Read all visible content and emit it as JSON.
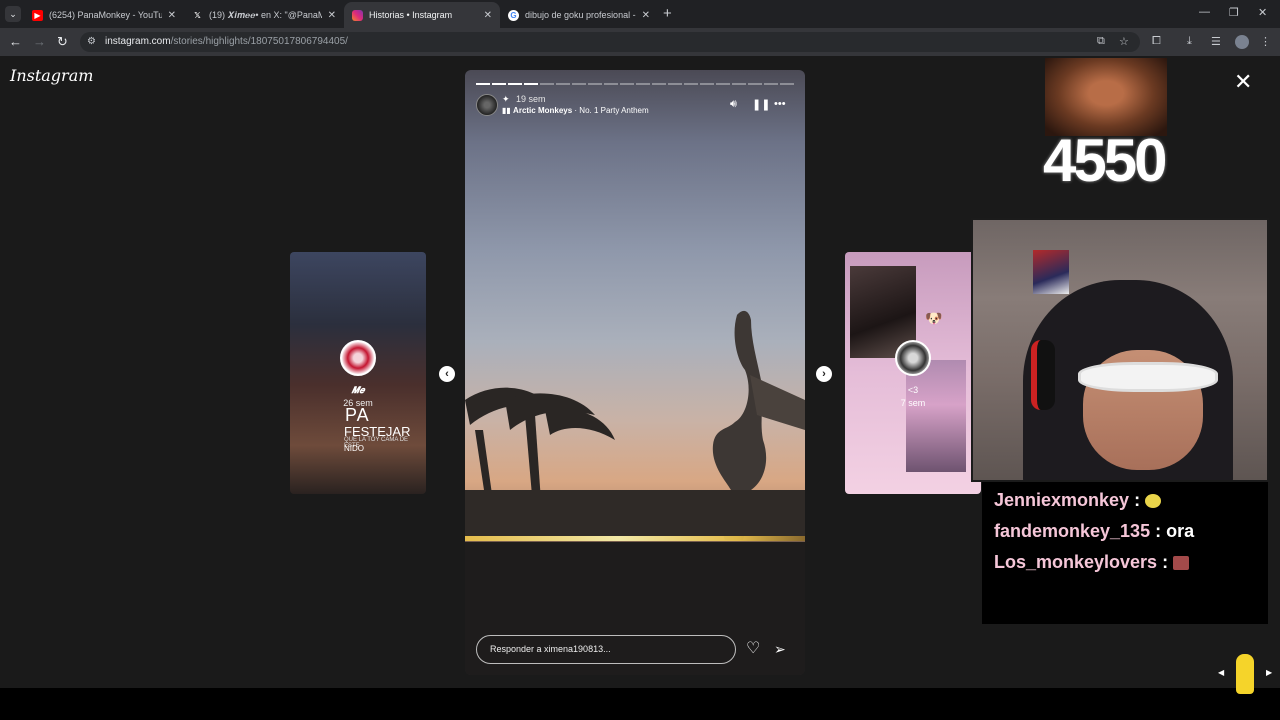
{
  "browser": {
    "tabs": [
      {
        "title": "(6254) PanaMonkey - YouTube",
        "favicon": "youtube-icon",
        "color": "#ff0000"
      },
      {
        "title": "(19) 𝑿𝒊𝒎𝒆𝒆• en X: \"@PanaMo",
        "favicon": "x-icon",
        "color": "#ffffff"
      },
      {
        "title": "Historias • Instagram",
        "favicon": "instagram-icon",
        "color": "#e1306c"
      },
      {
        "title": "dibujo de goku profesional - Bu",
        "favicon": "google-icon",
        "color": "#4285f4"
      }
    ],
    "url_domain": "instagram.com",
    "url_path": "/stories/highlights/18075017806794405/"
  },
  "instagram": {
    "logo": "Instagram",
    "close_symbol": "✕",
    "left_preview": {
      "name": "𝑴𝒆",
      "time": "26 sem",
      "text1": "PA",
      "text2": "FESTEJAR",
      "text3": "QUE LA TOY CAMA DE ESTE",
      "text4": "NIDO"
    },
    "right_preview": {
      "name": "<3",
      "time": "7 sem"
    },
    "story": {
      "time": "19 sem",
      "artist": "Arctic Monkeys",
      "song": " · No. 1 Party Anthem",
      "reply_placeholder": "Responder a ximena190813...",
      "segments_total": 20,
      "segments_done": 4
    }
  },
  "stream": {
    "counter": "4550",
    "chat": [
      {
        "user": "Jenniexmonkey",
        "msg": "",
        "emote_color": "#e9d44a"
      },
      {
        "user": "fandemonkey_135",
        "msg": "ora",
        "emote_color": ""
      },
      {
        "user": "Los_monkeylovers",
        "msg": "",
        "emote_color": "#a34a4a"
      }
    ]
  }
}
